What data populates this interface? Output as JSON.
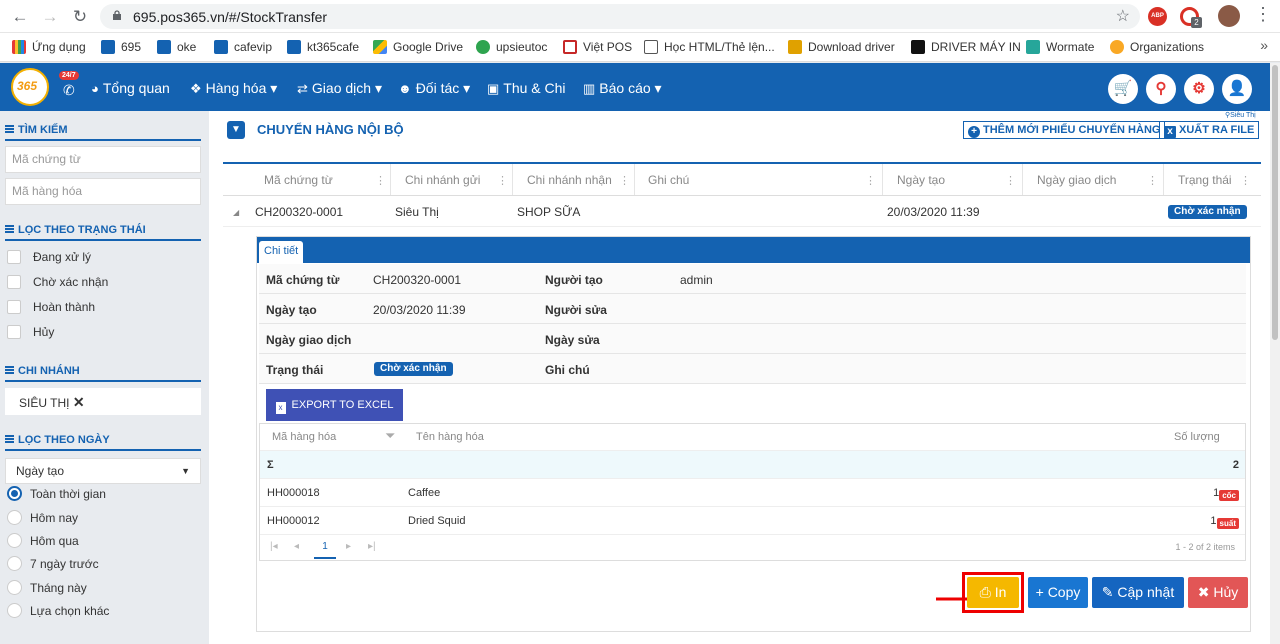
{
  "browser": {
    "url": "695.pos365.vn/#/StockTransfer",
    "ext_abp": "ABP",
    "ext_badge": "2",
    "bookmarks": [
      "Ứng dụng",
      "695",
      "oke",
      "cafevip",
      "kt365cafe",
      "Google Drive",
      "upsieutoc",
      "Việt POS",
      "Học HTML/Thẻ lện...",
      "Download driver",
      "DRIVER MÁY IN",
      "Wormate",
      "Organizations"
    ],
    "bookmarks_more": "»"
  },
  "app": {
    "logo": "365",
    "hotline_badge": "24/7",
    "menu": [
      "Tổng quan",
      "Hàng hóa ▾",
      "Giao dịch ▾",
      "Đối tác ▾",
      "Thu & Chi",
      "Báo cáo ▾"
    ],
    "menu_icons": [
      "dashboard-icon",
      "boxes-icon",
      "exchange-icon",
      "partners-icon",
      "money-icon",
      "bar-chart-icon"
    ]
  },
  "sidebar": {
    "search_title": "TÌM KIẾM",
    "search_doc_placeholder": "Mã chứng từ",
    "search_item_placeholder": "Mã hàng hóa",
    "status_title": "LỌC THEO TRẠNG THÁI",
    "statuses": [
      "Đang xử lý",
      "Chờ xác nhận",
      "Hoàn thành",
      "Hủy"
    ],
    "branch_title": "CHI NHÁNH",
    "branch_value": "SIÊU THỊ",
    "date_title": "LỌC THEO NGÀY",
    "date_field": "Ngày tạo",
    "date_options": [
      "Toàn thời gian",
      "Hôm nay",
      "Hôm qua",
      "7 ngày trước",
      "Tháng này",
      "Lựa chọn khác"
    ],
    "date_selected": "Toàn thời gian"
  },
  "page": {
    "title": "CHUYỂN HÀNG NỘI BỘ",
    "branch_tag": "Siêu Thị",
    "add_button": "THÊM MỚI PHIẾU CHUYỂN HÀNG",
    "export_button": "XUẤT RA FILE"
  },
  "grid": {
    "columns": [
      "Mã chứng từ",
      "Chi nhánh gửi",
      "Chi nhánh nhận",
      "Ghi chú",
      "Ngày tạo",
      "Ngày giao dịch",
      "Trạng thái"
    ],
    "row": {
      "code": "CH200320-0001",
      "from": "Siêu Thị",
      "to": "SHOP SỮA",
      "note": "",
      "created": "20/03/2020 11:39",
      "trans_date": "",
      "status": "Chờ xác nhận"
    }
  },
  "detail": {
    "tab": "Chi tiết",
    "labels": {
      "code": "Mã chứng từ",
      "creator": "Người tạo",
      "created": "Ngày tạo",
      "editor": "Người sửa",
      "trans_date": "Ngày giao dịch",
      "edited": "Ngày sửa",
      "status": "Trạng thái",
      "note": "Ghi chú"
    },
    "values": {
      "code": "CH200320-0001",
      "creator": "admin",
      "created": "20/03/2020 11:39",
      "status": "Chờ xác nhận"
    },
    "export_excel": "EXPORT TO EXCEL",
    "items_columns": [
      "Mã hàng hóa",
      "Tên hàng hóa",
      "Số lượng"
    ],
    "sum_symbol": "Σ",
    "sum_qty": "2",
    "items": [
      {
        "code": "HH000018",
        "name": "Caffee",
        "qty": "1",
        "unit": "cốc"
      },
      {
        "code": "HH000012",
        "name": "Dried Squid",
        "qty": "1",
        "unit": "suất"
      }
    ],
    "pager": {
      "first": "|◂",
      "prev": "◂",
      "page": "1",
      "next": "▸",
      "last": "▸|",
      "info": "1 - 2 of 2 items"
    },
    "actions": {
      "print": "In",
      "copy": "Copy",
      "update": "Cập nhật",
      "cancel": "Hủy"
    }
  },
  "colors": {
    "primary": "#1462b1",
    "print": "#f5b800",
    "copy": "#1976d2",
    "update": "#1565c0",
    "cancel": "#e25656",
    "highlight": "#e00000"
  }
}
